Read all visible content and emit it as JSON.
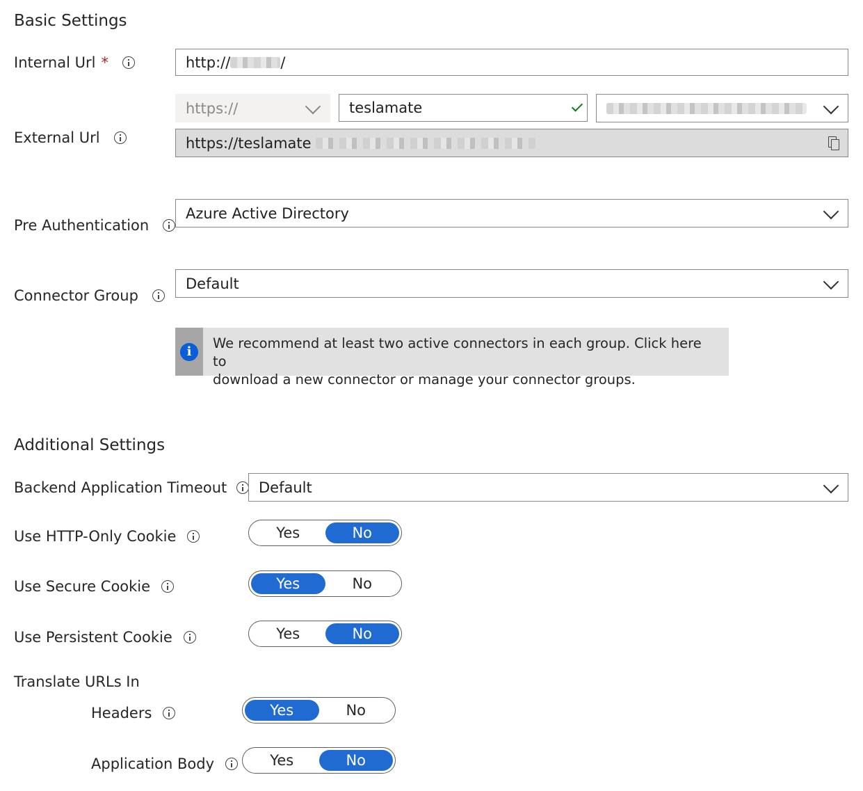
{
  "basic": {
    "title": "Basic Settings",
    "internal_url": {
      "label": "Internal Url",
      "required": "*",
      "value": "http://",
      "suffix": "/"
    },
    "external_url": {
      "label": "External Url",
      "scheme": "https://",
      "subdomain": "teslamate",
      "full_prefix": "https://teslamate"
    },
    "pre_auth": {
      "label": "Pre Authentication",
      "value": "Azure Active Directory"
    },
    "connector_group": {
      "label": "Connector Group",
      "value": "Default"
    },
    "banner": {
      "line1": "We recommend at least two active connectors in each group. Click here to",
      "line2": "download a new connector or manage your connector groups."
    }
  },
  "additional": {
    "title": "Additional Settings",
    "timeout": {
      "label": "Backend Application Timeout",
      "value": "Default"
    },
    "http_only": {
      "label": "Use HTTP-Only Cookie",
      "selected": "No"
    },
    "secure": {
      "label": "Use Secure Cookie",
      "selected": "Yes"
    },
    "persistent": {
      "label": "Use Persistent Cookie",
      "selected": "No"
    },
    "translate": {
      "label": "Translate URLs In"
    },
    "headers": {
      "label": "Headers",
      "selected": "Yes"
    },
    "body": {
      "label": "Application Body",
      "selected": "No"
    },
    "yes": "Yes",
    "no": "No"
  },
  "colors": {
    "accent": "#1f6bd2",
    "valid": "#107c10",
    "required": "#a4262c"
  }
}
